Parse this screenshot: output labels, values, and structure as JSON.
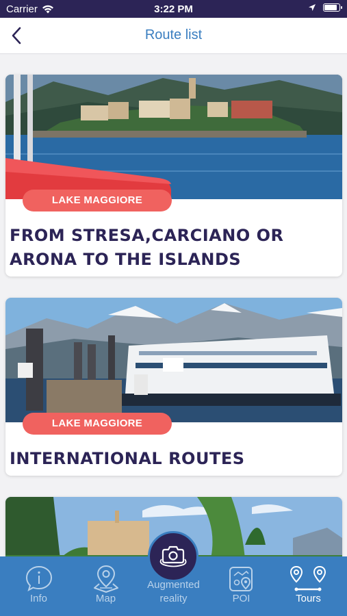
{
  "status_bar": {
    "carrier": "Carrier",
    "time": "3:22 PM",
    "battery_level": 0.9
  },
  "nav": {
    "title": "Route list",
    "back_icon": "chevron-left-icon"
  },
  "routes": [
    {
      "badge": "LAKE MAGGIORE",
      "title": "FROM STRESA,CARCIANO OR ARONA TO THE ISLANDS"
    },
    {
      "badge": "LAKE MAGGIORE",
      "title": "INTERNATIONAL ROUTES"
    },
    {
      "badge": "",
      "title": ""
    }
  ],
  "tab_bar": {
    "items": [
      {
        "label": "Info",
        "icon": "info-icon"
      },
      {
        "label": "Map",
        "icon": "map-pin-icon"
      },
      {
        "label": "Augmented reality",
        "icon": "camera-360-icon"
      },
      {
        "label": "POI",
        "icon": "poi-icon"
      },
      {
        "label": "Tours",
        "icon": "route-icon"
      }
    ],
    "active": "Tours"
  },
  "colors": {
    "primary": "#2c2456",
    "accent": "#3a7ec0",
    "badge": "#f0625f"
  }
}
